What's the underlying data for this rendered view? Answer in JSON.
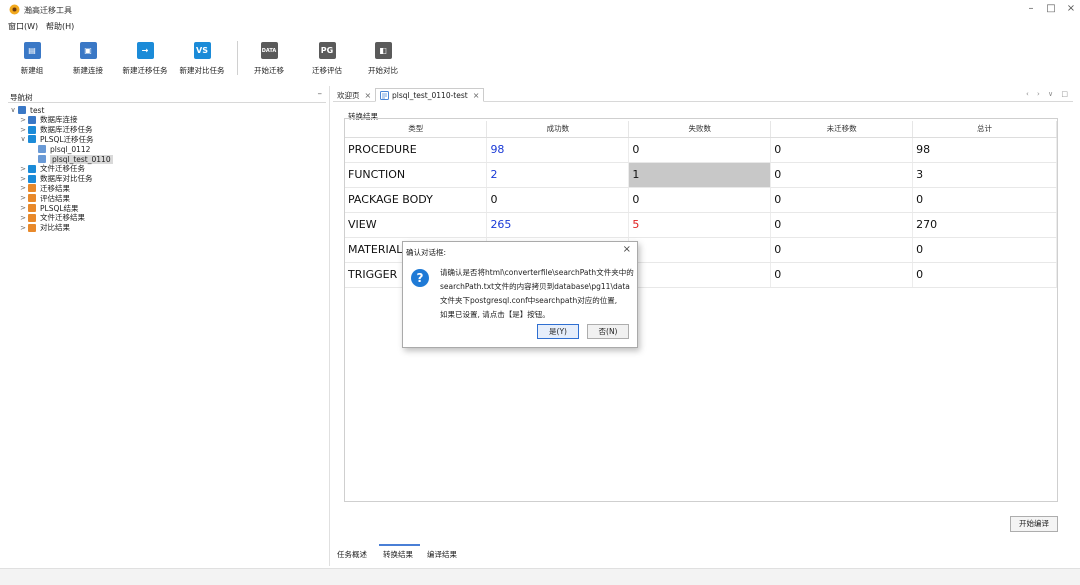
{
  "window": {
    "title": "瀚高迁移工具"
  },
  "menu": [
    "窗口(W)",
    "帮助(H)"
  ],
  "toolbar": [
    {
      "label": "新建组",
      "icon": "new-group-icon",
      "glyph": "▤",
      "color": "#3a78c6"
    },
    {
      "label": "新建连接",
      "icon": "new-connection-icon",
      "glyph": "▣",
      "color": "#3a78c6"
    },
    {
      "label": "新建迁移任务",
      "icon": "new-migration-task-icon",
      "glyph": "→",
      "color": "#1b8bd8"
    },
    {
      "label": "新建对比任务",
      "icon": "new-compare-task-icon",
      "glyph": "VS",
      "color": "#1b8bd8"
    },
    {
      "label": "开始迁移",
      "icon": "start-migration-icon",
      "glyph": "DATA",
      "color": "#5a5a5a"
    },
    {
      "label": "迁移评估",
      "icon": "migration-assess-icon",
      "glyph": "PG",
      "color": "#5a5a5a"
    },
    {
      "label": "开始对比",
      "icon": "start-compare-icon",
      "glyph": "◧",
      "color": "#5a5a5a"
    }
  ],
  "nav": {
    "title": "导航树",
    "items": [
      {
        "label": "test",
        "indent": 0,
        "chev": "∨",
        "color": "#3a78c6"
      },
      {
        "label": "数据库连接",
        "indent": 1,
        "chev": ">",
        "color": "#3a78c6"
      },
      {
        "label": "数据库迁移任务",
        "indent": 1,
        "chev": ">",
        "color": "#1b8bd8"
      },
      {
        "label": "PLSQL迁移任务",
        "indent": 1,
        "chev": "∨",
        "color": "#1b8bd8"
      },
      {
        "label": "plsql_0112",
        "indent": 2,
        "chev": "",
        "color": "#6a9ad6"
      },
      {
        "label": "plsql_test_0110",
        "indent": 2,
        "chev": "",
        "color": "#6a9ad6",
        "selected": true
      },
      {
        "label": "文件迁移任务",
        "indent": 1,
        "chev": ">",
        "color": "#1b8bd8"
      },
      {
        "label": "数据库对比任务",
        "indent": 1,
        "chev": ">",
        "color": "#1b8bd8"
      },
      {
        "label": "迁移结果",
        "indent": 1,
        "chev": ">",
        "color": "#e8892b"
      },
      {
        "label": "评估结果",
        "indent": 1,
        "chev": ">",
        "color": "#e8892b"
      },
      {
        "label": "PLSQL结果",
        "indent": 1,
        "chev": ">",
        "color": "#e8892b"
      },
      {
        "label": "文件迁移结果",
        "indent": 1,
        "chev": ">",
        "color": "#e8892b"
      },
      {
        "label": "对比结果",
        "indent": 1,
        "chev": ">",
        "color": "#e8892b"
      }
    ]
  },
  "tabs": [
    {
      "label": "欢迎页"
    },
    {
      "label": "plsql_test_0110-test",
      "active": true
    }
  ],
  "result": {
    "group_label": "转换结果",
    "columns": [
      "类型",
      "成功数",
      "失败数",
      "未迁移数",
      "总计"
    ],
    "rows": [
      [
        "PROCEDURE",
        "98",
        "0",
        "0",
        "98"
      ],
      [
        "FUNCTION",
        "2",
        "1",
        "0",
        "3"
      ],
      [
        "PACKAGE BODY",
        "0",
        "0",
        "0",
        "0"
      ],
      [
        "VIEW",
        "265",
        "5",
        "0",
        "270"
      ],
      [
        "MATERIAL",
        "",
        "",
        "0",
        "0"
      ],
      [
        "TRIGGER",
        "",
        "",
        "0",
        "0"
      ]
    ]
  },
  "compile_button": "开始编译",
  "bottom_tabs": [
    "任务概述",
    "转换结果",
    "编译结果"
  ],
  "dialog": {
    "title": "确认对话框:",
    "message_lines": [
      "请确认是否将html\\converterfile\\searchPath文件夹中的",
      "searchPath.txt文件的内容拷贝到database\\pg11\\data",
      "文件夹下postgresql.conf中searchpath对应的位置,",
      "如果已设置, 请点击【是】按钮。"
    ],
    "yes": "是(Y)",
    "no": "否(N)"
  }
}
